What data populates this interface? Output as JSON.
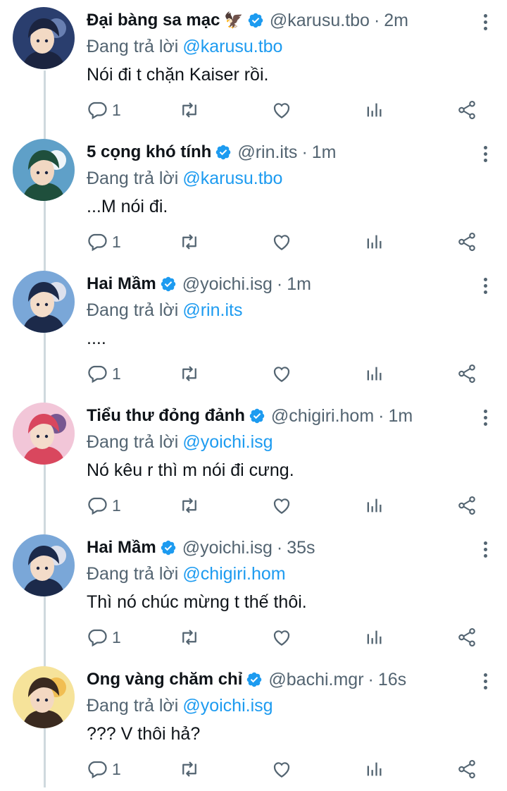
{
  "colors": {
    "accent": "#1d9bf0",
    "muted": "#536471",
    "text": "#0f1419",
    "thread": "#cfd9de"
  },
  "reply_prefix": "Đang trả lời",
  "tweets": [
    {
      "name": "Đại bàng sa mạc",
      "emoji": "🦅",
      "handle": "@karusu.tbo",
      "time": "2m",
      "reply_to": "@karusu.tbo",
      "text": "Nói đi t chặn Kaiser rồi.",
      "reply_count": "1"
    },
    {
      "name": "5 cọng khó tính",
      "emoji": "",
      "handle": "@rin.its",
      "time": "1m",
      "reply_to": "@karusu.tbo",
      "text": "...M nói đi.",
      "reply_count": "1"
    },
    {
      "name": "Hai Mầm",
      "emoji": "",
      "handle": "@yoichi.isg",
      "time": "1m",
      "reply_to": "@rin.its",
      "text": "....",
      "reply_count": "1"
    },
    {
      "name": "Tiểu thư đỏng đảnh",
      "emoji": "",
      "handle": "@chigiri.hom",
      "time": "1m",
      "reply_to": "@yoichi.isg",
      "text": "Nó kêu r thì m nói đi cưng.",
      "reply_count": "1"
    },
    {
      "name": "Hai Mầm",
      "emoji": "",
      "handle": "@yoichi.isg",
      "time": "35s",
      "reply_to": "@chigiri.hom",
      "text": "Thì nó chúc mừng t thế thôi.",
      "reply_count": "1"
    },
    {
      "name": "Ong vàng chăm chỉ",
      "emoji": "",
      "handle": "@bachi.mgr",
      "time": "16s",
      "reply_to": "@yoichi.isg",
      "text": "??? V thôi hả?",
      "reply_count": "1"
    }
  ]
}
